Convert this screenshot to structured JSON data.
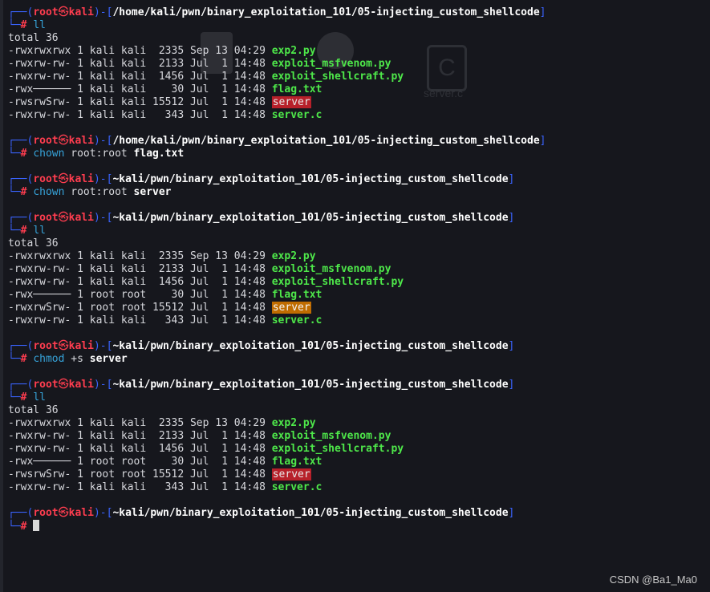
{
  "prompt": {
    "user": "root",
    "skull": "㉿",
    "host": "kali",
    "hash": "#"
  },
  "blocks": [
    {
      "path": "/home/kali/pwn/binary_exploitation_101/05-injecting_custom_shellcode",
      "cmd": "ll",
      "args": "",
      "argb": "",
      "total": "total 36",
      "files": [
        {
          "meta": "-rwxrwxrwx 1 kali kali  2335 Sep 13 04:29 ",
          "name": "exp2.py",
          "style": "green"
        },
        {
          "meta": "-rwxrw-rw- 1 kali kali  2133 Jul  1 14:48 ",
          "name": "exploit_msfvenom.py",
          "style": "green"
        },
        {
          "meta": "-rwxrw-rw- 1 kali kali  1456 Jul  1 14:48 ",
          "name": "exploit_shellcraft.py",
          "style": "green"
        },
        {
          "meta": "-rwx────── 1 kali kali    30 Jul  1 14:48 ",
          "name": "flag.txt",
          "style": "green"
        },
        {
          "meta": "-rwsrwSrw- 1 kali kali 15512 Jul  1 14:48 ",
          "name": "server",
          "style": "suid"
        },
        {
          "meta": "-rwxrw-rw- 1 kali kali   343 Jul  1 14:48 ",
          "name": "server.c",
          "style": "green"
        }
      ]
    },
    {
      "path": "/home/kali/pwn/binary_exploitation_101/05-injecting_custom_shellcode",
      "cmd": "chown",
      "args": " root:root ",
      "argb": "flag.txt",
      "files": []
    },
    {
      "path": "~kali/pwn/binary_exploitation_101/05-injecting_custom_shellcode",
      "cmd": "chown",
      "args": " root:root ",
      "argb": "server",
      "files": []
    },
    {
      "path": "~kali/pwn/binary_exploitation_101/05-injecting_custom_shellcode",
      "cmd": "ll",
      "args": "",
      "argb": "",
      "total": "total 36",
      "files": [
        {
          "meta": "-rwxrwxrwx 1 kali kali  2335 Sep 13 04:29 ",
          "name": "exp2.py",
          "style": "green"
        },
        {
          "meta": "-rwxrw-rw- 1 kali kali  2133 Jul  1 14:48 ",
          "name": "exploit_msfvenom.py",
          "style": "green"
        },
        {
          "meta": "-rwxrw-rw- 1 kali kali  1456 Jul  1 14:48 ",
          "name": "exploit_shellcraft.py",
          "style": "green"
        },
        {
          "meta": "-rwx────── 1 root root    30 Jul  1 14:48 ",
          "name": "flag.txt",
          "style": "green"
        },
        {
          "meta": "-rwxrwSrw- 1 root root 15512 Jul  1 14:48 ",
          "name": "server",
          "style": "sgid"
        },
        {
          "meta": "-rwxrw-rw- 1 kali kali   343 Jul  1 14:48 ",
          "name": "server.c",
          "style": "green"
        }
      ]
    },
    {
      "path": "~kali/pwn/binary_exploitation_101/05-injecting_custom_shellcode",
      "cmd": "chmod",
      "args": " +s ",
      "argb": "server",
      "files": []
    },
    {
      "path": "~kali/pwn/binary_exploitation_101/05-injecting_custom_shellcode",
      "cmd": "ll",
      "args": "",
      "argb": "",
      "total": "total 36",
      "files": [
        {
          "meta": "-rwxrwxrwx 1 kali kali  2335 Sep 13 04:29 ",
          "name": "exp2.py",
          "style": "green"
        },
        {
          "meta": "-rwxrw-rw- 1 kali kali  2133 Jul  1 14:48 ",
          "name": "exploit_msfvenom.py",
          "style": "green"
        },
        {
          "meta": "-rwxrw-rw- 1 kali kali  1456 Jul  1 14:48 ",
          "name": "exploit_shellcraft.py",
          "style": "green"
        },
        {
          "meta": "-rwx────── 1 root root    30 Jul  1 14:48 ",
          "name": "flag.txt",
          "style": "green"
        },
        {
          "meta": "-rwsrwSrw- 1 root root 15512 Jul  1 14:48 ",
          "name": "server",
          "style": "suid"
        },
        {
          "meta": "-rwxrw-rw- 1 kali kali   343 Jul  1 14:48 ",
          "name": "server.c",
          "style": "green"
        }
      ]
    },
    {
      "path": "~kali/pwn/binary_exploitation_101/05-injecting_custom_shellcode",
      "cmd": "",
      "args": "",
      "argb": "",
      "files": [],
      "active": true
    }
  ],
  "watermark": "CSDN @Ba1_Ma0",
  "background_hint": {
    "icon_letter": "C",
    "label": "server.c"
  },
  "colors": {
    "background": "#16171d",
    "prompt_red": "#ff3d4f",
    "box_blue": "#3a64ff",
    "command_cyan": "#36a3d9",
    "file_green": "#4ee84a",
    "suid_red": "#b7202a",
    "sgid_orange": "#c06c00"
  }
}
